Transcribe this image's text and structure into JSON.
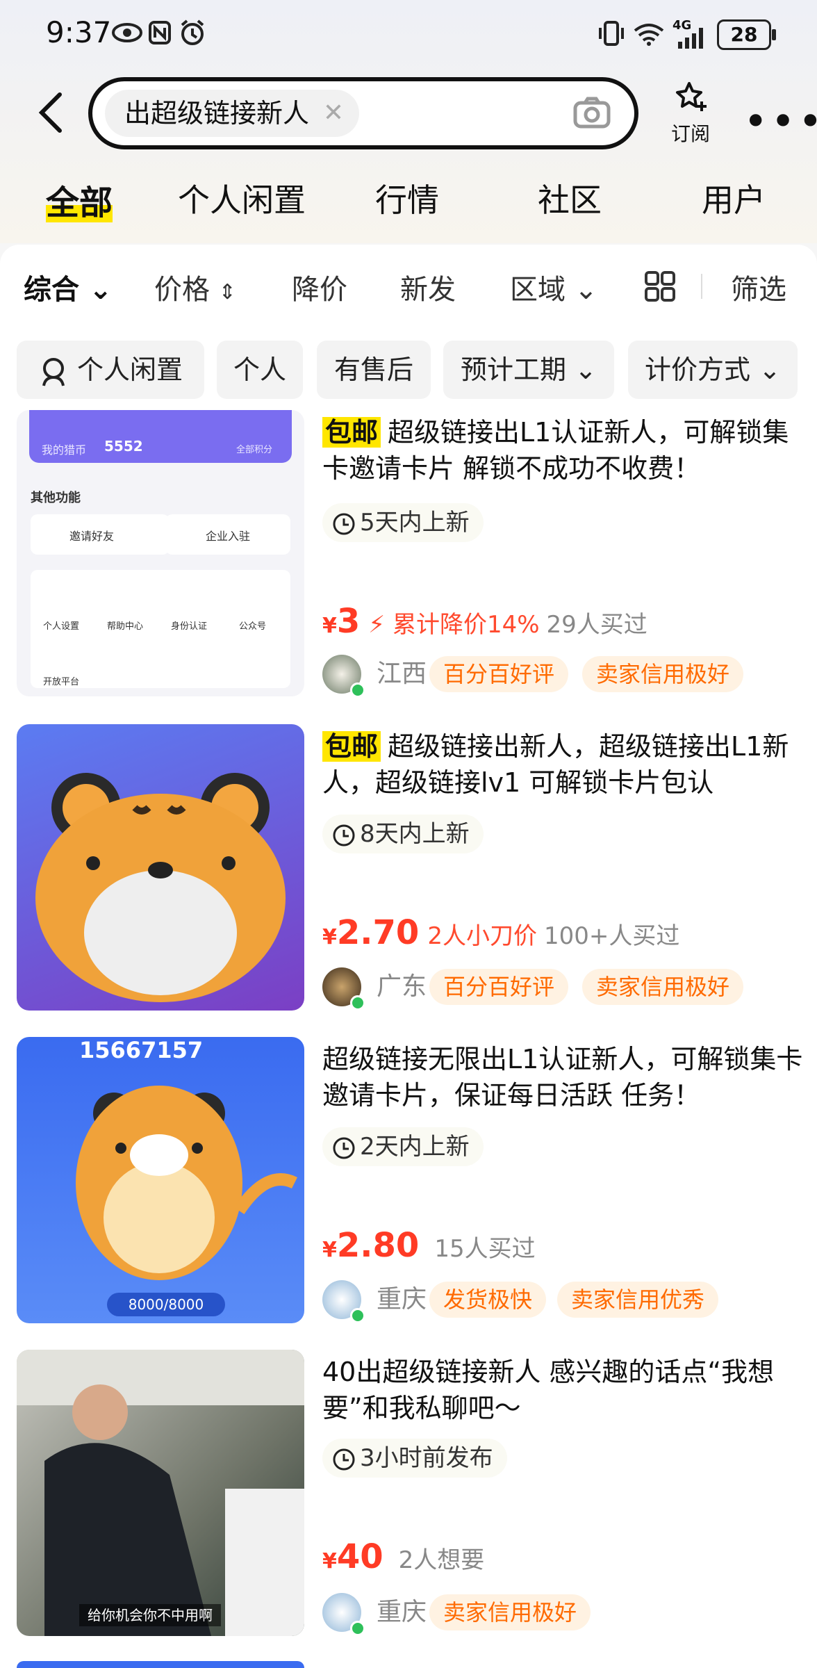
{
  "status_bar": {
    "time": "9:37",
    "battery": "28",
    "network": "4G"
  },
  "search": {
    "query": "出超级链接新人",
    "subscribe_label": "订阅"
  },
  "tabs": [
    "全部",
    "个人闲置",
    "行情",
    "社区",
    "用户"
  ],
  "sort_bar": [
    "综合",
    "价格",
    "降价",
    "新发",
    "区域",
    "筛选"
  ],
  "filters": [
    "个人闲置",
    "个人",
    "有售后",
    "预计工期",
    "计价方式"
  ],
  "items": [
    {
      "free_ship": "包邮",
      "title": "超级链接出L1认证新人，可解锁集卡邀请卡片 解锁不成功不收费！",
      "time": "5天内上新",
      "price": "3",
      "drop": "累计降价14%",
      "buyers": "29人买过",
      "region": "江西",
      "badges": [
        "百分百好评",
        "卖家信用极好"
      ],
      "thumb": {
        "coin_label": "我的猎币",
        "coin_value": "5552",
        "points": "全部积分",
        "section": "其他功能",
        "invite": "邀请好友",
        "company": "企业入驻",
        "f1": "个人设置",
        "f2": "帮助中心",
        "f3": "身份认证",
        "f4": "公众号",
        "f5": "开放平台"
      }
    },
    {
      "free_ship": "包邮",
      "title": "超级链接出新人，超级链接出L1新人，超级链接lv1 可解锁卡片包认",
      "time": "8天内上新",
      "price": "2.70",
      "drop": "2人小刀价",
      "buyers": "100+人买过",
      "region": "广东",
      "badges": [
        "百分百好评",
        "卖家信用极好"
      ]
    },
    {
      "free_ship": "",
      "title": "超级链接无限出L1认证新人，可解锁集卡邀请卡片，保证每日活跃 任务！",
      "time": "2天内上新",
      "price": "2.80",
      "drop": "",
      "buyers": "15人买过",
      "region": "重庆",
      "badges": [
        "发货极快",
        "卖家信用优秀"
      ],
      "thumb": {
        "coins": "15667157",
        "energy": "8000/8000"
      }
    },
    {
      "free_ship": "",
      "title": "40出超级链接新人 感兴趣的话点“我想要”和我私聊吧～",
      "time": "3小时前发布",
      "price": "40",
      "drop": "",
      "buyers": "2人想要",
      "region": "重庆",
      "badges": [
        "卖家信用极好"
      ],
      "thumb": {
        "caption": "给你机会你不中用啊"
      }
    }
  ],
  "colors": {
    "accent_yellow": "#ffe600",
    "price_red": "#ff3b25",
    "badge_orange": "#ff6a00",
    "online_green": "#2ec05a"
  }
}
